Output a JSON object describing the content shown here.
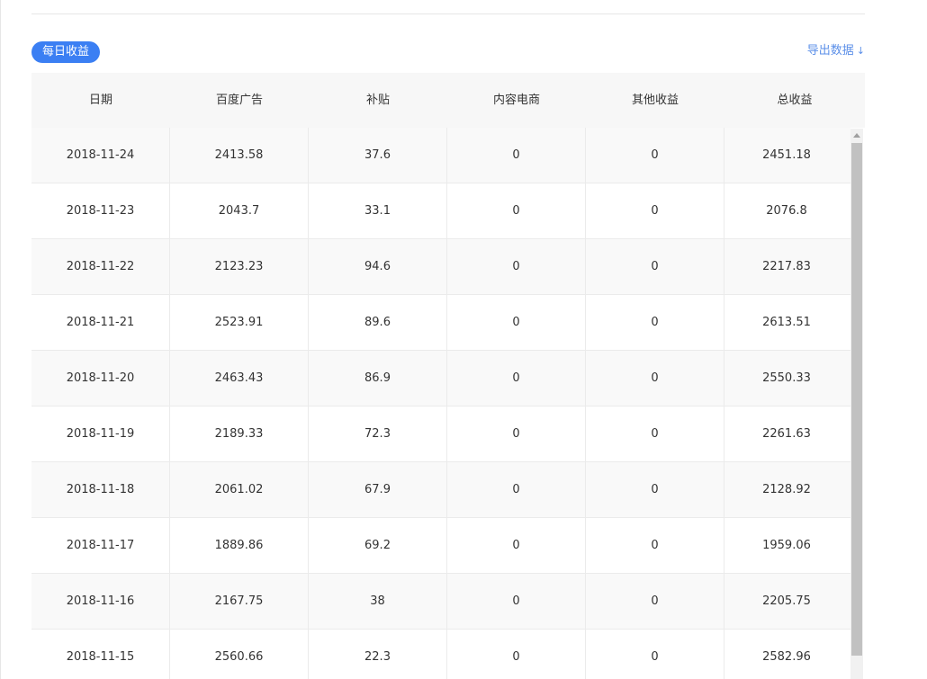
{
  "section": {
    "badge_label": "每日收益",
    "export_label": "导出数据",
    "export_icon": "download-arrow-icon"
  },
  "table": {
    "columns": [
      "日期",
      "百度广告",
      "补贴",
      "内容电商",
      "其他收益",
      "总收益"
    ],
    "rows": [
      [
        "2018-11-24",
        "2413.58",
        "37.6",
        "0",
        "0",
        "2451.18"
      ],
      [
        "2018-11-23",
        "2043.7",
        "33.1",
        "0",
        "0",
        "2076.8"
      ],
      [
        "2018-11-22",
        "2123.23",
        "94.6",
        "0",
        "0",
        "2217.83"
      ],
      [
        "2018-11-21",
        "2523.91",
        "89.6",
        "0",
        "0",
        "2613.51"
      ],
      [
        "2018-11-20",
        "2463.43",
        "86.9",
        "0",
        "0",
        "2550.33"
      ],
      [
        "2018-11-19",
        "2189.33",
        "72.3",
        "0",
        "0",
        "2261.63"
      ],
      [
        "2018-11-18",
        "2061.02",
        "67.9",
        "0",
        "0",
        "2128.92"
      ],
      [
        "2018-11-17",
        "1889.86",
        "69.2",
        "0",
        "0",
        "1959.06"
      ],
      [
        "2018-11-16",
        "2167.75",
        "38",
        "0",
        "0",
        "2205.75"
      ],
      [
        "2018-11-15",
        "2560.66",
        "22.3",
        "0",
        "0",
        "2582.96"
      ]
    ]
  },
  "colors": {
    "accent": "#3b7ff3",
    "link": "#5b8fe8",
    "header_bg": "#f7f7f7"
  }
}
